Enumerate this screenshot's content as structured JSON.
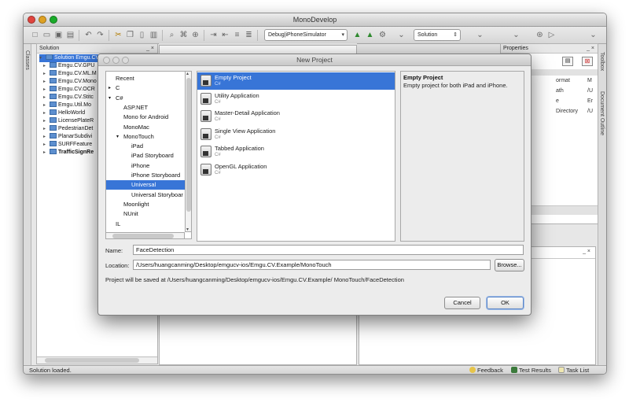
{
  "window": {
    "title": "MonoDevelop"
  },
  "toolbar": {
    "configuration": "Debug|iPhoneSimulator",
    "scope": "Solution"
  },
  "left_tabs": {
    "classes": "Classes"
  },
  "right_tabs": {
    "toolbox": "Toolbox",
    "document_outline": "Document Outline"
  },
  "solution_pad": {
    "title": "Solution",
    "items": [
      {
        "label": "Solution Emgu.CV.Example",
        "bold": false,
        "selected": true
      },
      {
        "label": "Emgu.CV.GPU",
        "bold": false
      },
      {
        "label": "Emgu.CV.ML.M",
        "bold": false
      },
      {
        "label": "Emgu.CV.Mono",
        "bold": false
      },
      {
        "label": "Emgu.CV.OCR",
        "bold": false
      },
      {
        "label": "Emgu.CV.Stitc",
        "bold": false
      },
      {
        "label": "Emgu.Util.Mo",
        "bold": false
      },
      {
        "label": "HelloWorld",
        "bold": false
      },
      {
        "label": "LicensePlateR",
        "bold": false
      },
      {
        "label": "PedestrianDet",
        "bold": false
      },
      {
        "label": "PlanarSubdivi",
        "bold": false
      },
      {
        "label": "SURFFeature",
        "bold": false
      },
      {
        "label": "TrafficSignRe",
        "bold": true
      }
    ]
  },
  "properties_pad": {
    "title": "Properties",
    "fragments": [
      "ormat",
      "M",
      "ath",
      "/U",
      "e",
      "Er",
      "Directory",
      "/U"
    ]
  },
  "statusbar": {
    "message": "Solution loaded.",
    "feedback": "Feedback",
    "test_results": "Test Results",
    "task_list": "Task List"
  },
  "dialog": {
    "title": "New Project",
    "categories": [
      {
        "label": "Recent",
        "indent": 0,
        "tri": ""
      },
      {
        "label": "C",
        "indent": 0,
        "tri": "▸"
      },
      {
        "label": "C#",
        "indent": 0,
        "tri": "▾"
      },
      {
        "label": "ASP.NET",
        "indent": 1,
        "tri": ""
      },
      {
        "label": "Mono for Android",
        "indent": 1,
        "tri": ""
      },
      {
        "label": "MonoMac",
        "indent": 1,
        "tri": ""
      },
      {
        "label": "MonoTouch",
        "indent": 1,
        "tri": "▾"
      },
      {
        "label": "iPad",
        "indent": 2,
        "tri": ""
      },
      {
        "label": "iPad Storyboard",
        "indent": 2,
        "tri": ""
      },
      {
        "label": "iPhone",
        "indent": 2,
        "tri": ""
      },
      {
        "label": "iPhone Storyboard",
        "indent": 2,
        "tri": ""
      },
      {
        "label": "Universal",
        "indent": 2,
        "tri": "",
        "selected": true
      },
      {
        "label": "Universal Storyboar",
        "indent": 2,
        "tri": ""
      },
      {
        "label": "Moonlight",
        "indent": 1,
        "tri": ""
      },
      {
        "label": "NUnit",
        "indent": 1,
        "tri": ""
      },
      {
        "label": "IL",
        "indent": 0,
        "tri": ""
      }
    ],
    "templates": [
      {
        "name": "Empty Project",
        "lang": "C#",
        "selected": true
      },
      {
        "name": "Utility Application",
        "lang": "C#"
      },
      {
        "name": "Master-Detail Application",
        "lang": "C#"
      },
      {
        "name": "Single View Application",
        "lang": "C#"
      },
      {
        "name": "Tabbed Application",
        "lang": "C#"
      },
      {
        "name": "OpenGL Application",
        "lang": "C#"
      }
    ],
    "description": {
      "title": "Empty Project",
      "text": "Empty project for both iPad and iPhone."
    },
    "name_label": "Name:",
    "name_value": "FaceDetection",
    "location_label": "Location:",
    "location_value": "/Users/huangcanming/Desktop/emgucv-ios/Emgu.CV.Example/MonoTouch",
    "browse_label": "Browse...",
    "saved_note": "Project will be saved at /Users/huangcanming/Desktop/emgucv-ios/Emgu.CV.Example/ MonoTouch/FaceDetection",
    "cancel_label": "Cancel",
    "ok_label": "OK"
  }
}
